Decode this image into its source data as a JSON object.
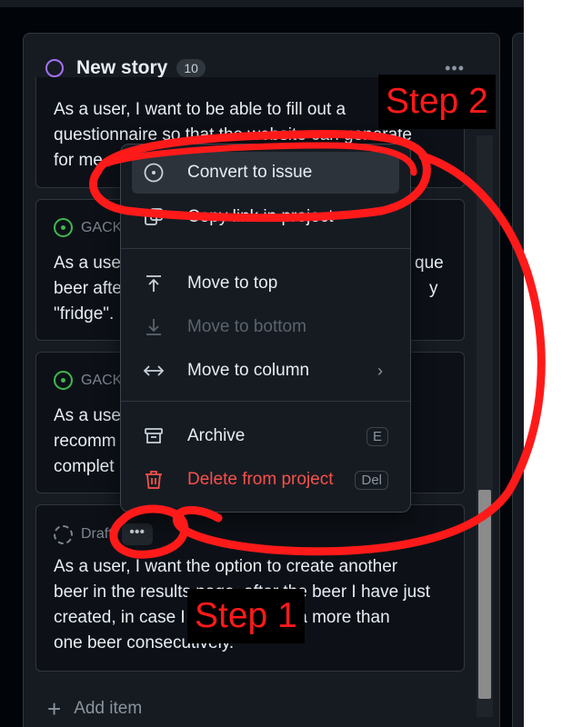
{
  "column": {
    "title": "New story",
    "count": "10"
  },
  "cards": [
    {
      "text_lines": [
        "As a user, I want to be able to fill out a",
        "questionnaire so that the website can generate",
        "for me."
      ]
    },
    {
      "meta": "GACK",
      "text_lines": [
        "As a user",
        "beer afte",
        "\"fridge\"."
      ],
      "right_fragments": [
        "que",
        "y"
      ]
    },
    {
      "meta": "GACK",
      "text_lines": [
        "As a use",
        "recomm",
        "complet"
      ]
    },
    {
      "meta": "Draft",
      "text_lines": [
        "As a user, I want the option to create another",
        "beer in the results page, after the beer I have just",
        "created, in case I want to make a more than",
        "one beer consecutively."
      ]
    }
  ],
  "card_dots": "•••",
  "column_menu": "•••",
  "context_menu": {
    "items": [
      {
        "label": "Convert to issue",
        "icon": "issue-opened-icon"
      },
      {
        "label": "Copy link in project",
        "icon": "copy-icon"
      },
      {
        "label": "Move to top",
        "icon": "move-to-top-icon"
      },
      {
        "label": "Move to bottom",
        "icon": "move-to-bottom-icon",
        "disabled": true
      },
      {
        "label": "Move to column",
        "icon": "arrow-both-icon"
      },
      {
        "label": "Archive",
        "icon": "archive-icon",
        "shortcut": "E"
      },
      {
        "label": "Delete from project",
        "icon": "trash-icon",
        "shortcut": "Del",
        "danger": true
      }
    ]
  },
  "add_item": "Add item",
  "annotations": {
    "step1": "Step 1",
    "step2": "Step 2",
    "color": "#ff1a1a"
  },
  "colors": {
    "accent_purple": "#a371f7",
    "issue_green": "#3fb950",
    "danger_red": "#f85149",
    "background": "#0d1117"
  }
}
